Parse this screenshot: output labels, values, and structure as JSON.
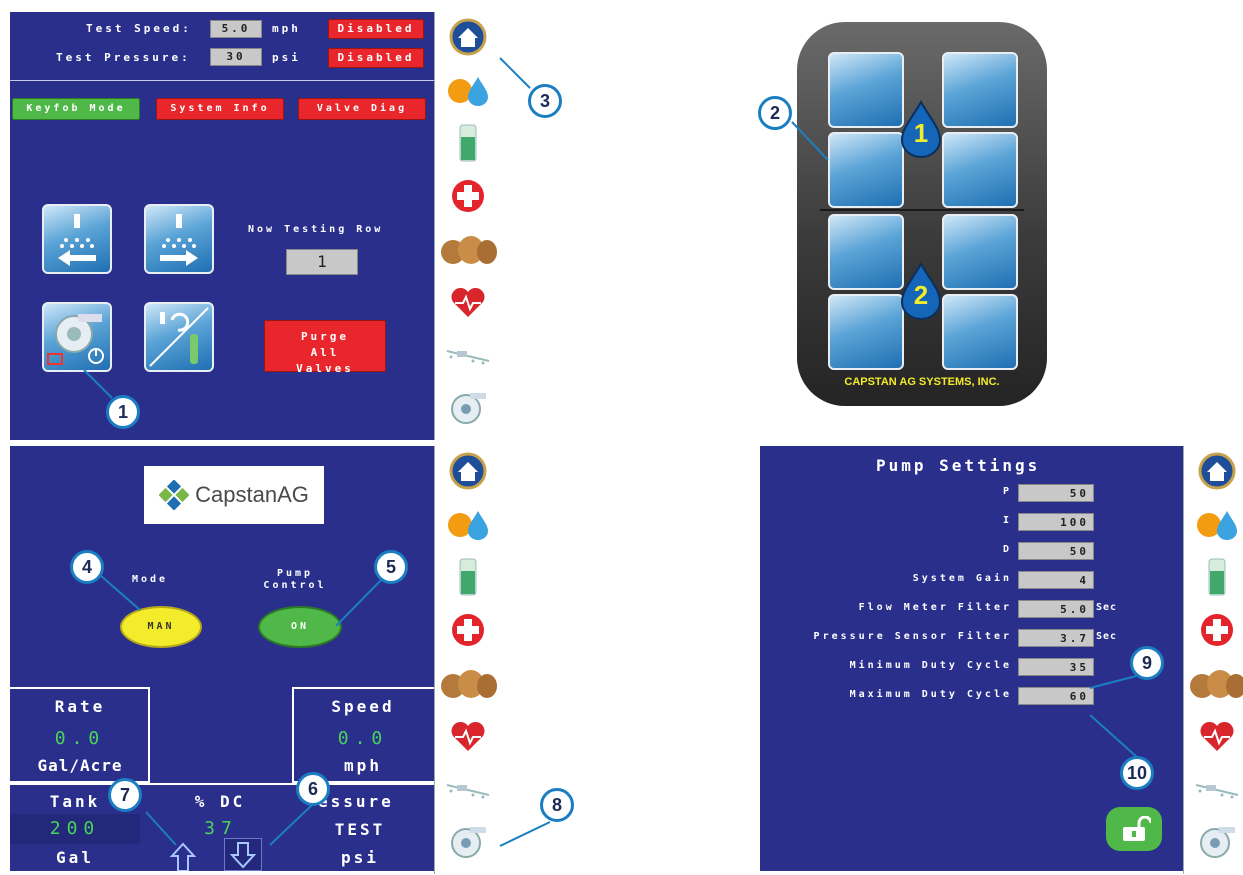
{
  "panel_a": {
    "test_speed_label": "Test Speed:",
    "test_speed_value": "5.0",
    "test_speed_unit": "mph",
    "test_speed_status": "Disabled",
    "test_pressure_label": "Test Pressure:",
    "test_pressure_value": "30",
    "test_pressure_unit": "psi",
    "test_pressure_status": "Disabled",
    "keyfob_mode": "Keyfob Mode",
    "system_info": "System Info",
    "valve_diag": "Valve Diag",
    "now_testing_label": "Now Testing Row",
    "now_testing_value": "1",
    "purge_label": "Purge All Valves"
  },
  "panel_b": {
    "brand_logo": "CAPSTAN AG SYSTEMS, INC.",
    "group_1": "1",
    "group_2": "2"
  },
  "panel_c": {
    "logo_text": "CapstanAG",
    "mode_label": "Mode",
    "mode_value": "MAN",
    "pump_control_label": "Pump Control",
    "pump_control_value": "ON",
    "rate_label": "Rate",
    "rate_value": "0.0",
    "rate_unit": "Gal/Acre",
    "speed_label": "Speed",
    "speed_value": "0.0",
    "speed_unit": "mph",
    "tank_label": "Tank",
    "tank_value": "200",
    "tank_unit": "Gal",
    "dc_label": "% DC",
    "dc_value": "37",
    "pressure_label": "essure",
    "pressure_value": "TEST",
    "pressure_unit": "psi"
  },
  "panel_d": {
    "title": "Pump Settings",
    "settings": [
      {
        "label": "P",
        "value": "50"
      },
      {
        "label": "I",
        "value": "100"
      },
      {
        "label": "D",
        "value": "50"
      },
      {
        "label": "System Gain",
        "value": "4"
      },
      {
        "label": "Flow Meter Filter",
        "value": "5.0",
        "unit": "Sec"
      },
      {
        "label": "Pressure Sensor Filter",
        "value": "3.7",
        "unit": "Sec"
      },
      {
        "label": "Minimum Duty Cycle",
        "value": "35"
      },
      {
        "label": "Maximum Duty Cycle",
        "value": "60"
      }
    ]
  },
  "callouts": [
    "1",
    "2",
    "3",
    "4",
    "5",
    "6",
    "7",
    "8",
    "9",
    "10"
  ],
  "sidebar_icons": [
    "home-icon",
    "fire-drop-icon",
    "tank-level-icon",
    "first-aid-icon",
    "hay-bales-icon",
    "heartbeat-icon",
    "sprayer-boom-icon",
    "pump-icon"
  ],
  "colors": {
    "panel": "#2a2f8c",
    "red": "#e8262b",
    "green": "#4fb848",
    "yellow": "#f3ec2a",
    "accent_blue": "#1b7ec2"
  }
}
